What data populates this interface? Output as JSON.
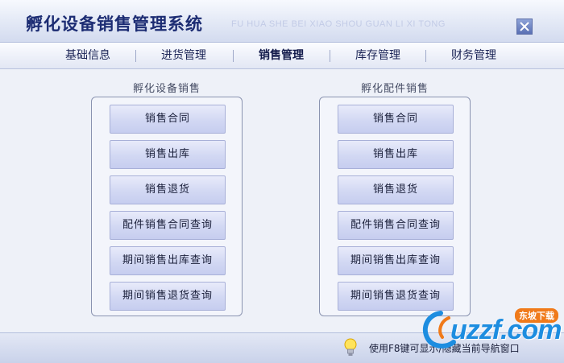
{
  "window": {
    "title": "孵化设备销售管理系统",
    "subtitle": "FU HUA SHE BEI XIAO SHOU GUAN LI XI TONG"
  },
  "menu": {
    "items": [
      {
        "label": "基础信息"
      },
      {
        "label": "进货管理"
      },
      {
        "label": "销售管理",
        "active": true
      },
      {
        "label": "库存管理"
      },
      {
        "label": "财务管理"
      }
    ]
  },
  "left_group": {
    "title": "孵化设备销售",
    "buttons": [
      "销售合同",
      "销售出库",
      "销售退货",
      "配件销售合同查询",
      "期间销售出库查询",
      "期间销售退货查询"
    ]
  },
  "right_group": {
    "title": "孵化配件销售",
    "buttons": [
      "销售合同",
      "销售出库",
      "销售退货",
      "配件销售合同查询",
      "期间销售出库查询",
      "期间销售退货查询"
    ]
  },
  "status": {
    "hint": "使用F8键可显示/隐藏当前导航窗口"
  },
  "watermark": {
    "logo_text": "uzzf.com",
    "tag": "东坡下载"
  },
  "colors": {
    "title_text": "#1c2c73",
    "button_bg": "#d2d8f3",
    "button_border": "#a8b0d8",
    "logo_accent": "#1d8de0"
  }
}
